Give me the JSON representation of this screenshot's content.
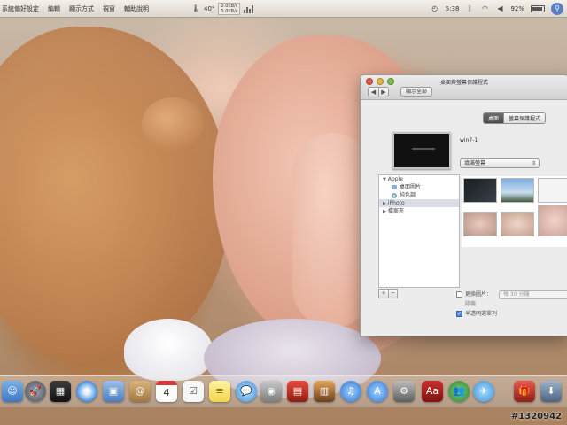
{
  "menubar": {
    "items": [
      "系統偏好設定",
      "編輯",
      "顯示方式",
      "視窗",
      "輔助說明"
    ],
    "status_left": {
      "temp": "40°",
      "net_up": "0.0KB/s",
      "net_down": "0.0KB/s"
    },
    "clock": "5:38",
    "battery": "92%",
    "icons": [
      "bluetooth-icon",
      "wifi-icon",
      "volume-icon",
      "battery-icon",
      "spotlight-icon"
    ]
  },
  "prefs_window": {
    "title": "桌面與螢幕保護程式",
    "show_all": "顯示全部",
    "tabs": [
      {
        "label": "桌面",
        "active": true
      },
      {
        "label": "螢幕保護程式",
        "active": false
      }
    ],
    "picture_name": "win7-1",
    "fit_option": "填滿螢幕",
    "sources": {
      "apple_header": "Apple",
      "desktop_pictures": "桌面圖片",
      "solid_colors": "純色調",
      "iphoto": "iPhoto",
      "folders": "檔案夾"
    },
    "options": {
      "change_picture": "更換圖片：",
      "interval": "每 30 分鐘",
      "random": "隨機",
      "translucent_menubar": "半透明選單列",
      "translucent_checked": true
    }
  },
  "dock": {
    "calendar_day": "4",
    "icons": [
      "finder-icon",
      "launchpad-icon",
      "mission-control-icon",
      "safari-icon",
      "preview-icon",
      "contacts-icon",
      "calendar-icon",
      "reminders-icon",
      "stickies-icon",
      "messages-icon",
      "facetime-icon",
      "photo-booth-icon",
      "image-capture-icon",
      "itunes-icon",
      "app-store-icon",
      "system-preferences-icon",
      "dictionary-icon",
      "people-icon",
      "mail-icon",
      "gift-icon",
      "downloads-icon"
    ]
  },
  "watermark": "#1320942"
}
